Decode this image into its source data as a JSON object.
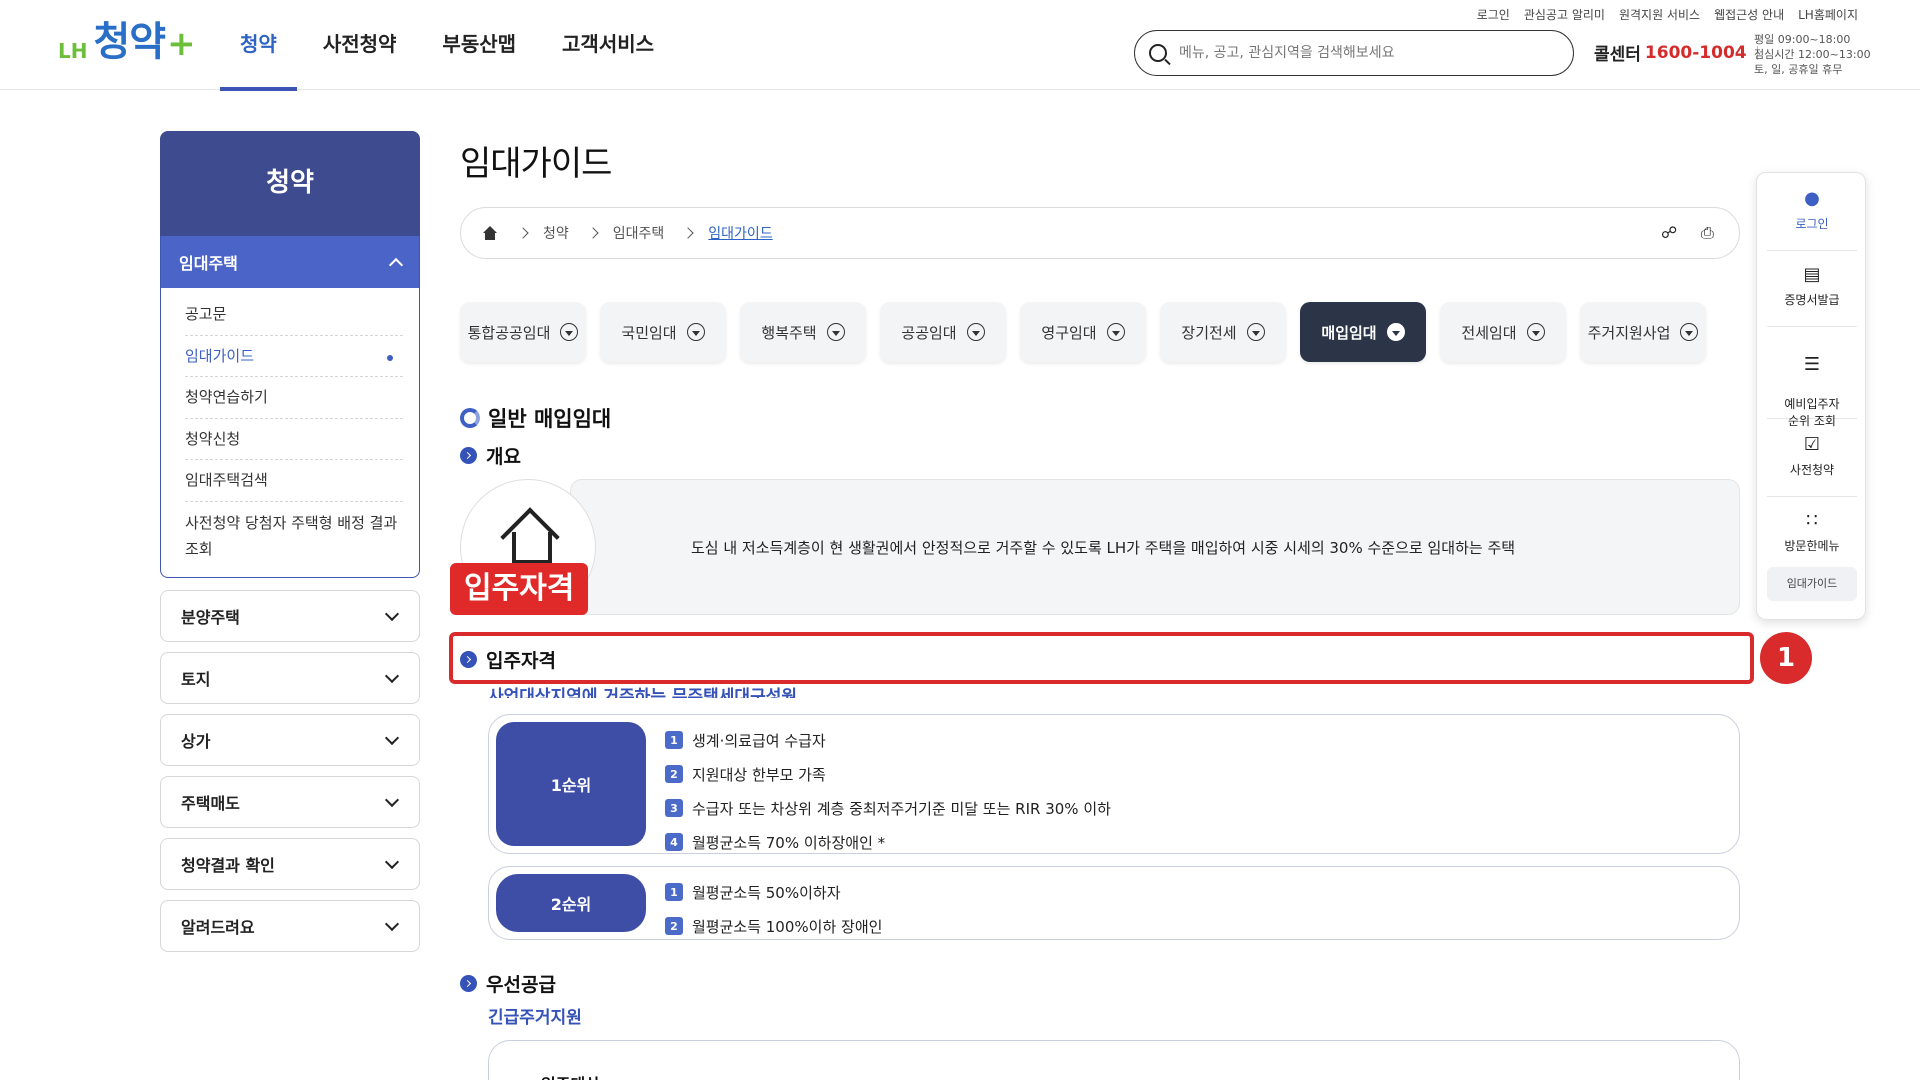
{
  "header": {
    "logo_lh": "LH",
    "logo_main": "청약",
    "logo_plus": "+",
    "nav": [
      "청약",
      "사전청약",
      "부동산맵",
      "고객서비스"
    ],
    "util_links": [
      "로그인",
      "관심공고 알리미",
      "원격지원 서비스",
      "웹접근성 안내",
      "LH홈페이지"
    ],
    "search_placeholder": "메뉴, 공고, 관심지역을 검색해보세요",
    "call_label": "콜센터",
    "call_number": "1600-1004",
    "hours_line1": "평일 09:00~18:00",
    "hours_line2": "점심시간 12:00~13:00",
    "hours_line3": "토, 일, 공휴일 휴무"
  },
  "sidebar": {
    "title": "청약",
    "section": "임대주택",
    "items": [
      "공고문",
      "임대가이드",
      "청약연습하기",
      "청약신청",
      "임대주택검색",
      "사전청약 당첨자 주택형 배정 결과 조회"
    ],
    "accordions": [
      "분양주택",
      "토지",
      "상가",
      "주택매도",
      "청약결과 확인",
      "알려드려요"
    ]
  },
  "main": {
    "page_title": "임대가이드",
    "breadcrumb": [
      "청약",
      "임대주택",
      "임대가이드"
    ],
    "tabs": [
      "통합공공임대",
      "국민임대",
      "행복주택",
      "공공임대",
      "영구임대",
      "장기전세",
      "매입임대",
      "전세임대",
      "주거지원사업"
    ],
    "active_tab": "매입임대",
    "section_title": "일반 매입임대",
    "overview_heading": "개요",
    "overview_text": "도심 내 저소득계층이 현 생활권에서 안정적으로 거주할 수 있도록 LH가 주택을 매입하여 시중 시세의 30% 수준으로 임대하는 주택",
    "red_label": "입주자격",
    "eligibility_heading": "입주자격",
    "eligibility_sub": "사업대상지역에 거주하는 무주택세대구성원",
    "rank1": {
      "label": "1순위",
      "items": [
        "생계·의료급여 수급자",
        "지원대상 한부모 가족",
        "수급자 또는 차상위 계층 중최저주거기준 미달 또는 RIR 30% 이하",
        "월평균소득 70% 이하장애인 *"
      ]
    },
    "rank2": {
      "label": "2순위",
      "items": [
        "월평균소득 50%이하자",
        "월평균소득 100%이하 장애인"
      ]
    },
    "priority_heading": "우선공급",
    "priority_sub": "긴급주거지원",
    "bottom_box_label": "입주대상",
    "annotation_badge": "1"
  },
  "quick_menu": {
    "items": [
      "로그인",
      "증명서발급",
      "예비입주자\n순위 조회",
      "사전청약",
      "방문한메뉴"
    ],
    "tag": "임대가이드"
  },
  "colors": {
    "brand_blue": "#3e4b8f",
    "accent_blue": "#3552b8",
    "highlight_red": "#d92b2b",
    "active_tab": "#2b3547"
  }
}
